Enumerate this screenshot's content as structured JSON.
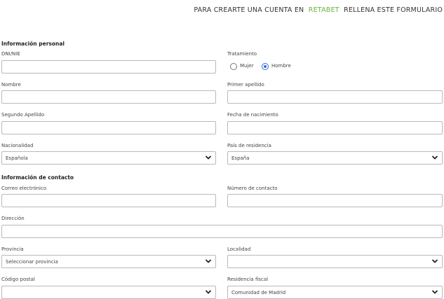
{
  "header": {
    "prefix": "PARA CREARTE UNA CUENTA EN",
    "brand": "RETABET",
    "suffix": "RELLENA ESTE FORMULARIO"
  },
  "sections": {
    "personal": "Información personal",
    "contact": "Información de contacto"
  },
  "fields": {
    "dni": {
      "label": "DNI/NIE",
      "value": ""
    },
    "treatment": {
      "label": "Tratamiento",
      "options": [
        "Mujer",
        "Hombre"
      ],
      "selected": "Hombre"
    },
    "nombre": {
      "label": "Nombre",
      "value": ""
    },
    "primer_apellido": {
      "label": "Primer apellido",
      "value": ""
    },
    "segundo_apellido": {
      "label": "Segundo Apellido",
      "value": ""
    },
    "fecha_nacimiento": {
      "label": "Fecha de nacimiento",
      "value": ""
    },
    "nacionalidad": {
      "label": "Nacionalidad",
      "value": "Española"
    },
    "pais_residencia": {
      "label": "País de residencia",
      "value": "España"
    },
    "correo": {
      "label": "Correo electrónico",
      "value": ""
    },
    "numero_contacto": {
      "label": "Número de contacto",
      "value": ""
    },
    "direccion": {
      "label": "Dirección",
      "value": ""
    },
    "provincia": {
      "label": "Provincia",
      "value": "Seleccionar provincia"
    },
    "localidad": {
      "label": "Localidad",
      "value": ""
    },
    "codigo_postal": {
      "label": "Código postal",
      "value": ""
    },
    "residencia_fiscal": {
      "label": "Residencia fiscal",
      "value": "Comunidad de Madrid"
    }
  }
}
